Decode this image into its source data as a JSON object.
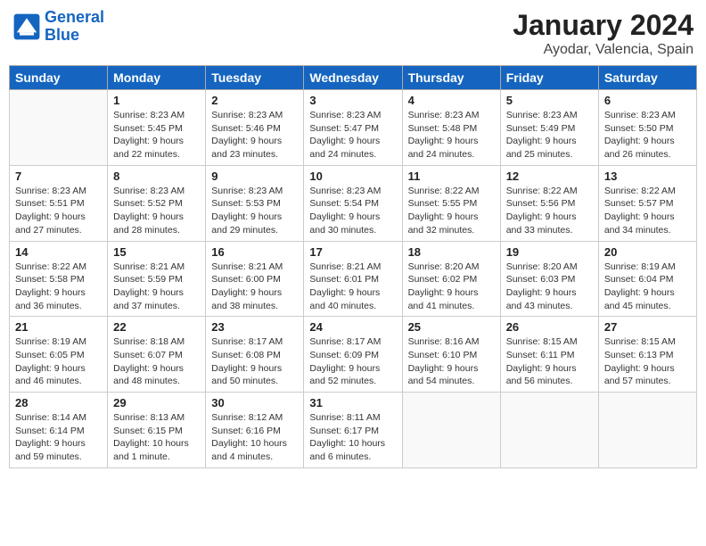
{
  "header": {
    "logo_line1": "General",
    "logo_line2": "Blue",
    "title": "January 2024",
    "subtitle": "Ayodar, Valencia, Spain"
  },
  "weekdays": [
    "Sunday",
    "Monday",
    "Tuesday",
    "Wednesday",
    "Thursday",
    "Friday",
    "Saturday"
  ],
  "weeks": [
    [
      {
        "day": "",
        "sunrise": "",
        "sunset": "",
        "daylight": ""
      },
      {
        "day": "1",
        "sunrise": "Sunrise: 8:23 AM",
        "sunset": "Sunset: 5:45 PM",
        "daylight": "Daylight: 9 hours and 22 minutes."
      },
      {
        "day": "2",
        "sunrise": "Sunrise: 8:23 AM",
        "sunset": "Sunset: 5:46 PM",
        "daylight": "Daylight: 9 hours and 23 minutes."
      },
      {
        "day": "3",
        "sunrise": "Sunrise: 8:23 AM",
        "sunset": "Sunset: 5:47 PM",
        "daylight": "Daylight: 9 hours and 24 minutes."
      },
      {
        "day": "4",
        "sunrise": "Sunrise: 8:23 AM",
        "sunset": "Sunset: 5:48 PM",
        "daylight": "Daylight: 9 hours and 24 minutes."
      },
      {
        "day": "5",
        "sunrise": "Sunrise: 8:23 AM",
        "sunset": "Sunset: 5:49 PM",
        "daylight": "Daylight: 9 hours and 25 minutes."
      },
      {
        "day": "6",
        "sunrise": "Sunrise: 8:23 AM",
        "sunset": "Sunset: 5:50 PM",
        "daylight": "Daylight: 9 hours and 26 minutes."
      }
    ],
    [
      {
        "day": "7",
        "sunrise": "Sunrise: 8:23 AM",
        "sunset": "Sunset: 5:51 PM",
        "daylight": "Daylight: 9 hours and 27 minutes."
      },
      {
        "day": "8",
        "sunrise": "Sunrise: 8:23 AM",
        "sunset": "Sunset: 5:52 PM",
        "daylight": "Daylight: 9 hours and 28 minutes."
      },
      {
        "day": "9",
        "sunrise": "Sunrise: 8:23 AM",
        "sunset": "Sunset: 5:53 PM",
        "daylight": "Daylight: 9 hours and 29 minutes."
      },
      {
        "day": "10",
        "sunrise": "Sunrise: 8:23 AM",
        "sunset": "Sunset: 5:54 PM",
        "daylight": "Daylight: 9 hours and 30 minutes."
      },
      {
        "day": "11",
        "sunrise": "Sunrise: 8:22 AM",
        "sunset": "Sunset: 5:55 PM",
        "daylight": "Daylight: 9 hours and 32 minutes."
      },
      {
        "day": "12",
        "sunrise": "Sunrise: 8:22 AM",
        "sunset": "Sunset: 5:56 PM",
        "daylight": "Daylight: 9 hours and 33 minutes."
      },
      {
        "day": "13",
        "sunrise": "Sunrise: 8:22 AM",
        "sunset": "Sunset: 5:57 PM",
        "daylight": "Daylight: 9 hours and 34 minutes."
      }
    ],
    [
      {
        "day": "14",
        "sunrise": "Sunrise: 8:22 AM",
        "sunset": "Sunset: 5:58 PM",
        "daylight": "Daylight: 9 hours and 36 minutes."
      },
      {
        "day": "15",
        "sunrise": "Sunrise: 8:21 AM",
        "sunset": "Sunset: 5:59 PM",
        "daylight": "Daylight: 9 hours and 37 minutes."
      },
      {
        "day": "16",
        "sunrise": "Sunrise: 8:21 AM",
        "sunset": "Sunset: 6:00 PM",
        "daylight": "Daylight: 9 hours and 38 minutes."
      },
      {
        "day": "17",
        "sunrise": "Sunrise: 8:21 AM",
        "sunset": "Sunset: 6:01 PM",
        "daylight": "Daylight: 9 hours and 40 minutes."
      },
      {
        "day": "18",
        "sunrise": "Sunrise: 8:20 AM",
        "sunset": "Sunset: 6:02 PM",
        "daylight": "Daylight: 9 hours and 41 minutes."
      },
      {
        "day": "19",
        "sunrise": "Sunrise: 8:20 AM",
        "sunset": "Sunset: 6:03 PM",
        "daylight": "Daylight: 9 hours and 43 minutes."
      },
      {
        "day": "20",
        "sunrise": "Sunrise: 8:19 AM",
        "sunset": "Sunset: 6:04 PM",
        "daylight": "Daylight: 9 hours and 45 minutes."
      }
    ],
    [
      {
        "day": "21",
        "sunrise": "Sunrise: 8:19 AM",
        "sunset": "Sunset: 6:05 PM",
        "daylight": "Daylight: 9 hours and 46 minutes."
      },
      {
        "day": "22",
        "sunrise": "Sunrise: 8:18 AM",
        "sunset": "Sunset: 6:07 PM",
        "daylight": "Daylight: 9 hours and 48 minutes."
      },
      {
        "day": "23",
        "sunrise": "Sunrise: 8:17 AM",
        "sunset": "Sunset: 6:08 PM",
        "daylight": "Daylight: 9 hours and 50 minutes."
      },
      {
        "day": "24",
        "sunrise": "Sunrise: 8:17 AM",
        "sunset": "Sunset: 6:09 PM",
        "daylight": "Daylight: 9 hours and 52 minutes."
      },
      {
        "day": "25",
        "sunrise": "Sunrise: 8:16 AM",
        "sunset": "Sunset: 6:10 PM",
        "daylight": "Daylight: 9 hours and 54 minutes."
      },
      {
        "day": "26",
        "sunrise": "Sunrise: 8:15 AM",
        "sunset": "Sunset: 6:11 PM",
        "daylight": "Daylight: 9 hours and 56 minutes."
      },
      {
        "day": "27",
        "sunrise": "Sunrise: 8:15 AM",
        "sunset": "Sunset: 6:13 PM",
        "daylight": "Daylight: 9 hours and 57 minutes."
      }
    ],
    [
      {
        "day": "28",
        "sunrise": "Sunrise: 8:14 AM",
        "sunset": "Sunset: 6:14 PM",
        "daylight": "Daylight: 9 hours and 59 minutes."
      },
      {
        "day": "29",
        "sunrise": "Sunrise: 8:13 AM",
        "sunset": "Sunset: 6:15 PM",
        "daylight": "Daylight: 10 hours and 1 minute."
      },
      {
        "day": "30",
        "sunrise": "Sunrise: 8:12 AM",
        "sunset": "Sunset: 6:16 PM",
        "daylight": "Daylight: 10 hours and 4 minutes."
      },
      {
        "day": "31",
        "sunrise": "Sunrise: 8:11 AM",
        "sunset": "Sunset: 6:17 PM",
        "daylight": "Daylight: 10 hours and 6 minutes."
      },
      {
        "day": "",
        "sunrise": "",
        "sunset": "",
        "daylight": ""
      },
      {
        "day": "",
        "sunrise": "",
        "sunset": "",
        "daylight": ""
      },
      {
        "day": "",
        "sunrise": "",
        "sunset": "",
        "daylight": ""
      }
    ]
  ]
}
